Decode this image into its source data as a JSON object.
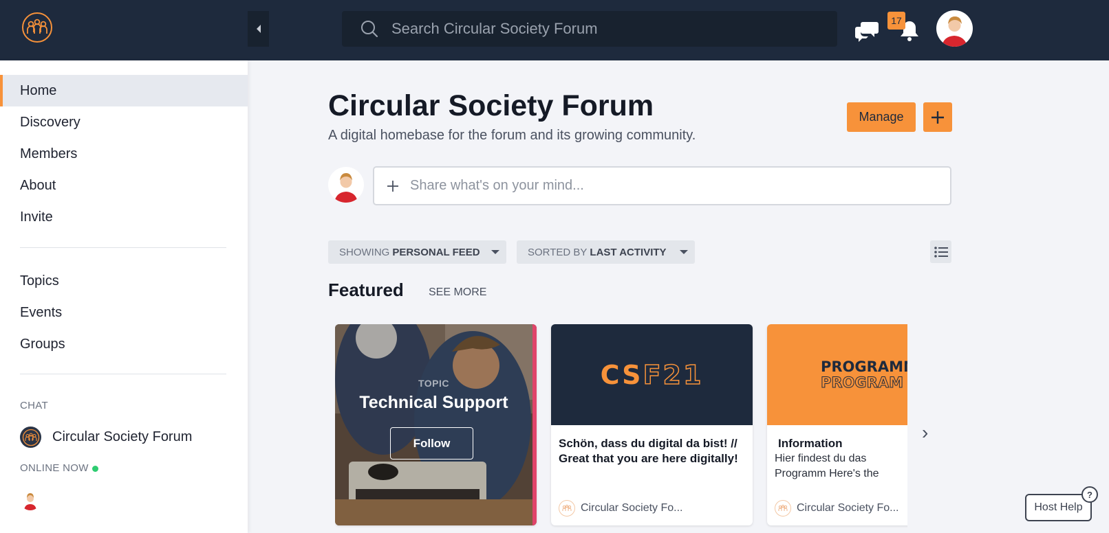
{
  "app": {
    "brand_color": "#f7923a",
    "topbar_color": "#1e2a3d"
  },
  "topbar": {
    "search_placeholder": "Search Circular Society Forum",
    "notification_count": "17",
    "icons": [
      "community-logo-icon",
      "collapse-left-icon",
      "search-icon",
      "chat-bubbles-icon",
      "bell-icon"
    ]
  },
  "sidebar": {
    "items": [
      {
        "label": "Home",
        "active": true
      },
      {
        "label": "Discovery"
      },
      {
        "label": "Members"
      },
      {
        "label": "About"
      },
      {
        "label": "Invite"
      },
      {
        "label": "Topics"
      },
      {
        "label": "Events"
      },
      {
        "label": "Groups"
      }
    ],
    "chat_label": "CHAT",
    "chat_item": "Circular Society Forum",
    "online_label": "ONLINE NOW"
  },
  "main": {
    "title": "Circular Society Forum",
    "subtitle": "A digital homebase for the forum and its growing community.",
    "manage_label": "Manage",
    "composer_placeholder": "Share what's on your mind...",
    "filter_showing_prefix": "SHOWING",
    "filter_showing_value": "PERSONAL FEED",
    "filter_sorted_prefix": "SORTED BY",
    "filter_sorted_value": "LAST ACTIVITY",
    "featured_title": "Featured",
    "see_more": "SEE MORE"
  },
  "cards": [
    {
      "kind": "TOPIC",
      "name": "Technical Support",
      "action": "Follow"
    },
    {
      "banner_text_a": "CS",
      "banner_text_b": "F21",
      "title": "Schön, dass du digital da bist! // Great that you are here digitally!",
      "footer": "Circular Society Fo..."
    },
    {
      "banner_line_1": "PROGRAMM",
      "banner_line_2": "PROGRAM",
      "title": "Information",
      "text": "Hier findest du das Programm Here's the program...",
      "footer": "Circular Society Fo..."
    }
  ],
  "host_help": "Host Help"
}
